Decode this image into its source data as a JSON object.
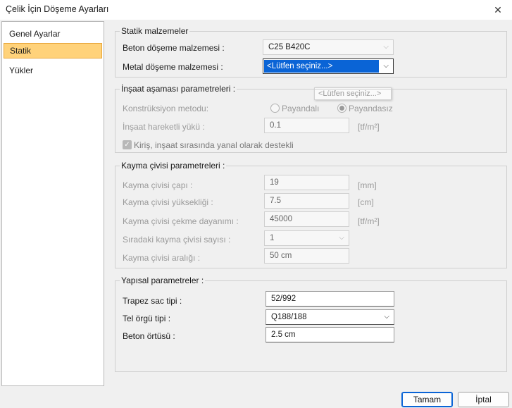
{
  "window": {
    "title": "Çelik İçin Döşeme Ayarları",
    "close_glyph": "✕"
  },
  "sidebar": {
    "items": [
      {
        "label": "Genel Ayarlar"
      },
      {
        "label": "Statik"
      },
      {
        "label": "Yükler"
      }
    ]
  },
  "statik": {
    "title": "Statik malzemeler",
    "beton_label": "Beton döşeme malzemesi :",
    "beton_value": "C25 B420C",
    "metal_label": "Metal döşeme malzemesi :",
    "metal_value": "<Lütfen seçiniz...>",
    "tooltip": "<Lütfen seçiniz...>"
  },
  "insaat": {
    "title": "İnşaat aşaması parametreleri :",
    "method_label": "Konstrüksiyon metodu:",
    "radio_1": "Payandalı",
    "radio_2": "Payandasız",
    "load_label": "İnşaat hareketli yükü :",
    "load_value": "0.1",
    "load_unit": "[tf/m²]",
    "check_label": "Kiriş, inşaat sırasında yanal olarak destekli",
    "check_glyph": "✓"
  },
  "kayma": {
    "title": "Kayma çivisi parametreleri :",
    "rows": [
      {
        "label": "Kayma çivisi çapı :",
        "value": "19",
        "unit": "[mm]"
      },
      {
        "label": "Kayma çivisi yüksekliği :",
        "value": "7.5",
        "unit": "[cm]"
      },
      {
        "label": "Kayma çivisi çekme dayanımı :",
        "value": "45000",
        "unit": "[tf/m²]"
      },
      {
        "label": "Sıradaki kayma çivisi sayısı :",
        "value": "1",
        "unit": ""
      },
      {
        "label": "Kayma çivisi aralığı :",
        "value": "50 cm",
        "unit": ""
      }
    ]
  },
  "yapisal": {
    "title": "Yapısal parametreler :",
    "trapez_label": "Trapez sac tipi :",
    "trapez_value": "52/992",
    "tel_label": "Tel örgü tipi :",
    "tel_value": "Q188/188",
    "beton_label": "Beton örtüsü :",
    "beton_value": "2.5 cm"
  },
  "icons": {
    "dropdown": "chevron-down-icon",
    "arrow_glyph": "⌵"
  },
  "footer": {
    "ok": "Tamam",
    "cancel": "İptal"
  },
  "colors": {
    "accent": "#0a64d6",
    "active_nav": "#ffd27a"
  }
}
